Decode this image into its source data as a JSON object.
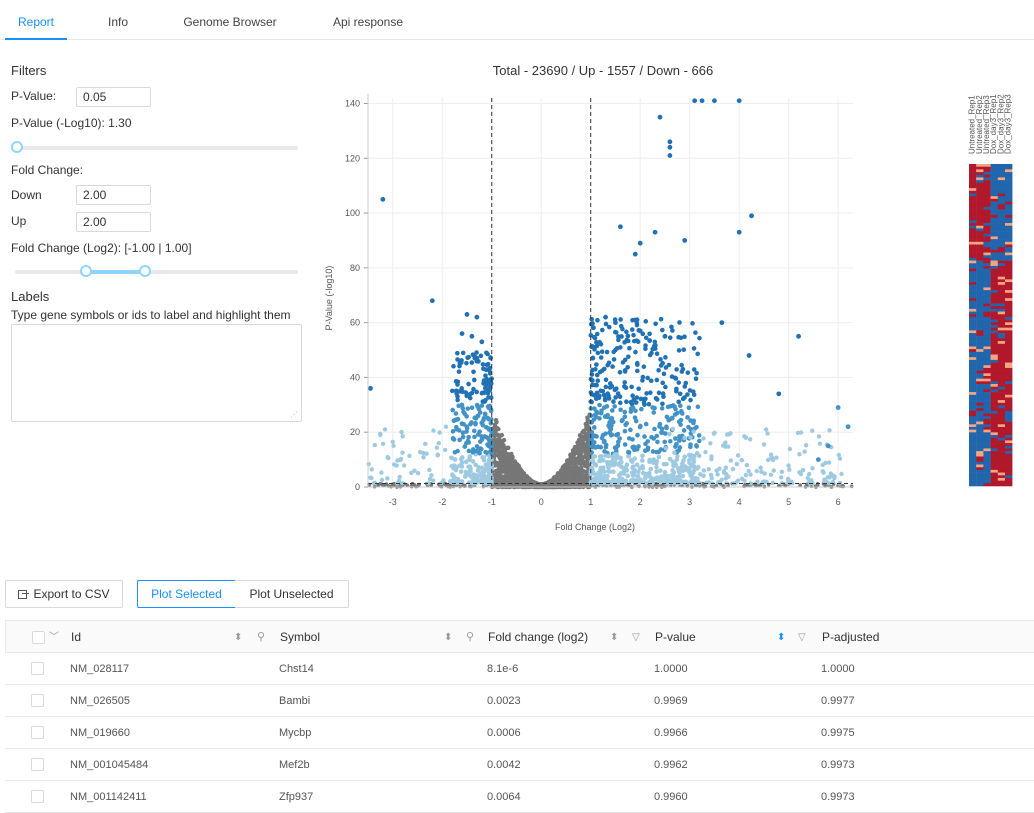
{
  "tabs": [
    {
      "label": "Report",
      "active": true
    },
    {
      "label": "Info",
      "active": false
    },
    {
      "label": "Genome Browser",
      "active": false
    },
    {
      "label": "Api response",
      "active": false
    }
  ],
  "filters": {
    "title": "Filters",
    "pvalue_label": "P-Value:",
    "pvalue_value": "0.05",
    "pvalue_log_label": "P-Value (-Log10): 1.30",
    "pvalue_slider_level": 0.0,
    "fold_change_label": "Fold Change:",
    "down_label": "Down",
    "down_value": "2.00",
    "up_label": "Up",
    "up_value": "2.00",
    "fold_log_label": "Fold Change (Log2): [-1.00 | 1.00]",
    "fold_slider_range": [
      0.25,
      0.46
    ]
  },
  "labels_section": {
    "title": "Labels",
    "hint": "Type gene symbols or ids to label and highlight them",
    "value": ""
  },
  "chart_data": {
    "type": "scatter",
    "title": "Total - 23690 / Up - 1557 / Down - 666",
    "xlabel": "Fold Change (Log2)",
    "ylabel": "P-Value (-log10)",
    "xlim": [
      -3.5,
      6.3
    ],
    "ylim": [
      0,
      142
    ],
    "xticks": [
      -3,
      -2,
      -1,
      0,
      1,
      2,
      3,
      4,
      5,
      6
    ],
    "yticks": [
      0,
      20,
      40,
      60,
      80,
      100,
      120,
      140
    ],
    "fold_threshold": [
      -1,
      1
    ],
    "pvalue_threshold": 1.3,
    "grid": true,
    "colors": {
      "not_significant": "#777777",
      "low": "#9ecae1",
      "mid": "#4292c6",
      "high": "#2171b5"
    },
    "highlight_points": [
      [
        -3.2,
        105
      ],
      [
        -2.2,
        68
      ],
      [
        -3.45,
        36
      ],
      [
        2.0,
        89
      ],
      [
        2.3,
        93
      ],
      [
        1.9,
        85
      ],
      [
        2.6,
        126
      ],
      [
        2.6,
        124
      ],
      [
        2.6,
        121
      ],
      [
        2.4,
        135
      ],
      [
        3.1,
        141
      ],
      [
        3.25,
        141
      ],
      [
        3.5,
        141
      ],
      [
        4.0,
        141
      ],
      [
        4.25,
        99
      ],
      [
        4.0,
        93
      ],
      [
        2.9,
        90
      ],
      [
        1.6,
        95
      ],
      [
        3.65,
        60
      ],
      [
        4.2,
        48
      ],
      [
        5.2,
        55
      ],
      [
        1.3,
        62
      ],
      [
        1.5,
        60
      ],
      [
        2.0,
        57
      ],
      [
        2.5,
        55
      ],
      [
        -1.3,
        62
      ],
      [
        -1.5,
        63
      ],
      [
        -1.6,
        56
      ],
      [
        -1.4,
        55
      ],
      [
        -1.2,
        53
      ],
      [
        6.0,
        29
      ],
      [
        6.2,
        22
      ],
      [
        5.8,
        15
      ],
      [
        4.8,
        34
      ],
      [
        5.6,
        10
      ]
    ]
  },
  "heatmap": {
    "columns": [
      "Untreated_Rep1",
      "Untreated_Rep2",
      "Untreated_Rep3",
      "Dox_day3_Rep1",
      "Dox_day3_Rep2",
      "Dox_day3_Rep3"
    ],
    "up_fraction": 0.3,
    "colors": {
      "red": "#b2182b",
      "blue": "#2166ac",
      "light": "#f4a582"
    }
  },
  "actions": {
    "export_label": "Export to CSV",
    "plot_selected_label": "Plot Selected",
    "plot_unselected_label": "Plot Unselected"
  },
  "table": {
    "columns": [
      "Id",
      "Symbol",
      "Fold change (log2)",
      "P-value",
      "P-adjusted"
    ],
    "rows": [
      {
        "id": "NM_028117",
        "symbol": "Chst14",
        "fc": "8.1e-6",
        "pvalue": "1.0000",
        "padj": "1.0000"
      },
      {
        "id": "NM_026505",
        "symbol": "Bambi",
        "fc": "0.0023",
        "pvalue": "0.9969",
        "padj": "0.9977"
      },
      {
        "id": "NM_019660",
        "symbol": "Mycbp",
        "fc": "0.0006",
        "pvalue": "0.9966",
        "padj": "0.9975"
      },
      {
        "id": "NM_001045484",
        "symbol": "Mef2b",
        "fc": "0.0042",
        "pvalue": "0.9962",
        "padj": "0.9973"
      },
      {
        "id": "NM_001142411",
        "symbol": "Zfp937",
        "fc": "0.0064",
        "pvalue": "0.9960",
        "padj": "0.9973"
      }
    ]
  }
}
